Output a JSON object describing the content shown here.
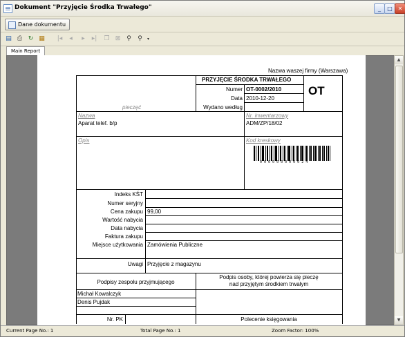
{
  "window": {
    "title": "Dokument \"Przyjęcie Środka Trwałego\""
  },
  "toolbar": {
    "dane_label": "Dane dokumentu"
  },
  "tabs": [
    {
      "label": "Main Report"
    }
  ],
  "status": {
    "current_page": "Current Page No.: 1",
    "total_page": "Total Page No.: 1",
    "zoom": "Zoom Factor: 100%"
  },
  "report": {
    "company": "Nazwa waszej firmy (Warszawa)",
    "doc_title": "PRZYJĘCIE ŚRODKA TRWAŁEGO",
    "code": "OT",
    "pieczec": "pieczęć",
    "labels": {
      "numer": "Numer",
      "data": "Data",
      "wydano": "Wydano według",
      "nazwa": "Nazwa",
      "nr_inw": "Nr. inwentarzowy",
      "opis": "Opis",
      "kod": "Kod kreskowy"
    },
    "values": {
      "numer": "OT-0002/2010",
      "data": "2010-12-20",
      "nazwa": "Aparat telef. b/p",
      "nr_inw": "ADM/ZP/18/02",
      "barcode_digits": "0 0 0 0 0 0 0 0 0 0 2 4"
    },
    "rows": [
      {
        "label": "Indeks KŚT",
        "value": ""
      },
      {
        "label": "Numer seryjny",
        "value": ""
      },
      {
        "label": "Cena zakupu",
        "value": "99,00"
      },
      {
        "label": "Wartość nabycia",
        "value": ""
      },
      {
        "label": "Data nabycia",
        "value": ""
      },
      {
        "label": "Faktura zakupu",
        "value": ""
      },
      {
        "label": "Miejsce użytkowania",
        "value": "Zamówienia Publiczne"
      },
      {
        "label": "Uwagi",
        "value": "Przyjęcie z magazynu"
      }
    ],
    "sign_left": "Podpisy zespołu przyjmującego",
    "sign_right_1": "Podpis osoby, której powierza się pieczę",
    "sign_right_2": "nad przyjętym środkiem trwałym",
    "signers": [
      "Michał Kowalczyk",
      "Denis Pujdak"
    ],
    "nr_pk": "Nr. PK",
    "polecenie": "Polecenie księgowania"
  }
}
